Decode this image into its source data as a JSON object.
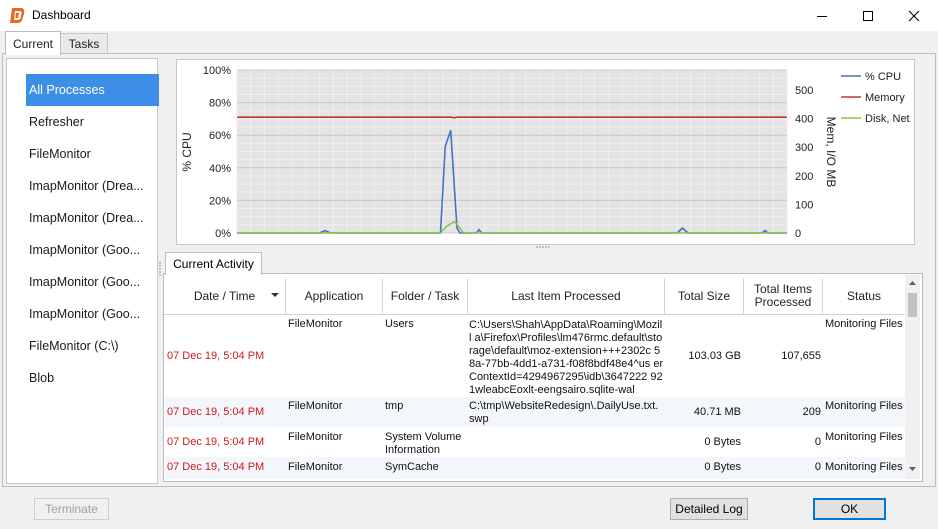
{
  "window": {
    "title": "Dashboard"
  },
  "tabs": [
    "Current",
    "Tasks"
  ],
  "processes": [
    "All Processes",
    "Refresher",
    "FileMonitor",
    "ImapMonitor (Drea...",
    "ImapMonitor (Drea...",
    "ImapMonitor (Goo...",
    "ImapMonitor (Goo...",
    "ImapMonitor (Goo...",
    "FileMonitor (C:\\)",
    "Blob"
  ],
  "chart_data": {
    "type": "line",
    "y_left_ticks": [
      "100%",
      "80%",
      "60%",
      "40%",
      "20%",
      "0%"
    ],
    "y_left_label": "% CPU",
    "y_right_ticks": [
      "500",
      "400",
      "300",
      "200",
      "100",
      "0"
    ],
    "y_right_label": "Mem, I/O MB",
    "ylim_left": [
      0,
      100
    ],
    "ylim_right": [
      0,
      570
    ],
    "legend_position": "right",
    "grid": true,
    "series": [
      {
        "name": "% CPU",
        "color": "#4472c4",
        "axis": "left",
        "points": [
          [
            0,
            0
          ],
          [
            0.3,
            0
          ],
          [
            0.32,
            1.5
          ],
          [
            0.34,
            0
          ],
          [
            0.74,
            0
          ],
          [
            0.757,
            53
          ],
          [
            0.777,
            63
          ],
          [
            0.8,
            3
          ],
          [
            0.81,
            0
          ],
          [
            0.87,
            0
          ],
          [
            0.88,
            2
          ],
          [
            0.89,
            0
          ],
          [
            1.6,
            0
          ],
          [
            1.62,
            3
          ],
          [
            1.64,
            0
          ],
          [
            1.91,
            0
          ],
          [
            1.92,
            1.5
          ],
          [
            1.93,
            0
          ],
          [
            2,
            0
          ]
        ]
      },
      {
        "name": "Memory",
        "color": "#c0392b",
        "axis": "right",
        "points": [
          [
            0,
            405
          ],
          [
            0.78,
            405
          ],
          [
            0.79,
            403
          ],
          [
            0.8,
            405
          ],
          [
            2,
            405
          ]
        ]
      },
      {
        "name": "Disk, Net",
        "color": "#8bc34a",
        "axis": "right",
        "points": [
          [
            0,
            0
          ],
          [
            0.74,
            0
          ],
          [
            0.76,
            22
          ],
          [
            0.79,
            40
          ],
          [
            0.8,
            30
          ],
          [
            0.82,
            3
          ],
          [
            0.83,
            0
          ],
          [
            2,
            0
          ]
        ]
      }
    ],
    "x_range": [
      0,
      2
    ]
  },
  "activity": {
    "tab_label": "Current Activity",
    "columns": [
      "Date / Time",
      "Application",
      "Folder / Task",
      "Last Item Processed",
      "Total Size",
      "Total Items Processed",
      "Status"
    ],
    "rows": [
      {
        "time": "07 Dec 19, 5:04 PM",
        "app": "FileMonitor",
        "folder": "Users",
        "item": "C:\\Users\\Shah\\AppData\\Roaming\\Mozill a\\Firefox\\Profiles\\lm476rmc.default\\sto rage\\default\\moz-extension+++2302c 58a-77bb-4dd1-a731-f08f8bdf48e4^us erContextId=4294967295\\idb\\3647222 921wleabcEoxlt-eengsairo.sqlite-wal",
        "size": "103.03 GB",
        "count": "107,655",
        "status": "Monitoring Files"
      },
      {
        "time": "07 Dec 19, 5:04 PM",
        "app": "FileMonitor",
        "folder": "tmp",
        "item": "C:\\tmp\\WebsiteRedesign\\.DailyUse.txt. swp",
        "size": "40.71 MB",
        "count": "209",
        "status": "Monitoring Files"
      },
      {
        "time": "07 Dec 19, 5:04 PM",
        "app": "FileMonitor",
        "folder": "System Volume Information",
        "item": "",
        "size": "0 Bytes",
        "count": "0",
        "status": "Monitoring Files"
      },
      {
        "time": "07 Dec 19, 5:04 PM",
        "app": "FileMonitor",
        "folder": "SymCache",
        "item": "",
        "size": "0 Bytes",
        "count": "0",
        "status": "Monitoring Files"
      }
    ]
  },
  "buttons": {
    "terminate": "Terminate",
    "detailed_log": "Detailed Log",
    "ok": "OK"
  }
}
